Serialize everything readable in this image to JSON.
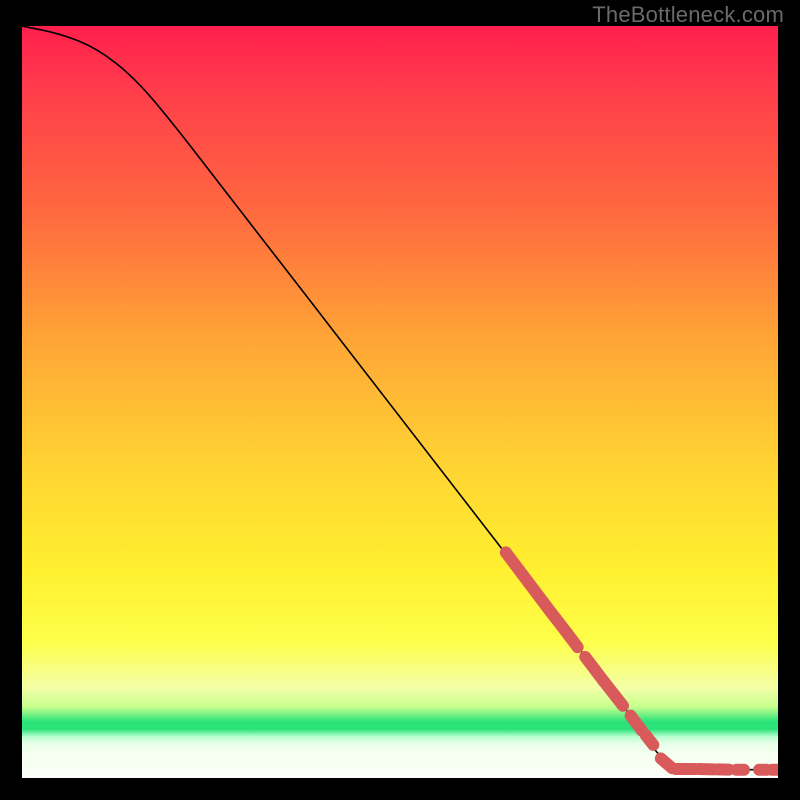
{
  "watermark": "TheBottleneck.com",
  "chart_data": {
    "type": "line",
    "title": "",
    "xlabel": "",
    "ylabel": "",
    "xlim": [
      0,
      100
    ],
    "ylim": [
      0,
      100
    ],
    "series": [
      {
        "name": "curve",
        "x": [
          0,
          5,
          10,
          15,
          20,
          25,
          30,
          35,
          40,
          45,
          50,
          55,
          60,
          65,
          70,
          75,
          80,
          82,
          85,
          90,
          95,
          100
        ],
        "y": [
          100,
          99,
          97,
          93,
          87,
          80.5,
          74,
          67.5,
          61,
          54.5,
          48,
          41.5,
          35,
          28.5,
          22,
          15.5,
          9,
          6,
          2,
          1.2,
          1.1,
          1.1
        ]
      }
    ],
    "highlight_segments": [
      {
        "x0": 64,
        "y0": 30.0,
        "x1": 67,
        "y1": 26.0
      },
      {
        "x0": 67,
        "y0": 26.0,
        "x1": 70,
        "y1": 22.0
      },
      {
        "x0": 70,
        "y0": 22.0,
        "x1": 72,
        "y1": 19.4
      },
      {
        "x0": 72,
        "y0": 19.4,
        "x1": 73.5,
        "y1": 17.4
      },
      {
        "x0": 74.5,
        "y0": 16.1,
        "x1": 77,
        "y1": 12.8
      },
      {
        "x0": 77,
        "y0": 12.8,
        "x1": 79.5,
        "y1": 9.6
      },
      {
        "x0": 80.5,
        "y0": 8.3,
        "x1": 82,
        "y1": 6.3
      },
      {
        "x0": 82.5,
        "y0": 5.7,
        "x1": 83.5,
        "y1": 4.4
      },
      {
        "x0": 84.5,
        "y0": 2.6,
        "x1": 86,
        "y1": 1.3
      },
      {
        "x0": 86.5,
        "y0": 1.2,
        "x1": 89,
        "y1": 1.2
      },
      {
        "x0": 89.5,
        "y0": 1.2,
        "x1": 91.5,
        "y1": 1.15
      },
      {
        "x0": 92,
        "y0": 1.15,
        "x1": 93.5,
        "y1": 1.12
      },
      {
        "x0": 94.5,
        "y0": 1.1,
        "x1": 95.5,
        "y1": 1.1
      },
      {
        "x0": 97.5,
        "y0": 1.1,
        "x1": 98.5,
        "y1": 1.1
      },
      {
        "x0": 99.2,
        "y0": 1.1,
        "x1": 100,
        "y1": 1.1
      }
    ],
    "gradient_bands": [
      {
        "color": "red-pink",
        "from_pct": 0,
        "to_pct": 30
      },
      {
        "color": "orange",
        "from_pct": 30,
        "to_pct": 60
      },
      {
        "color": "yellow",
        "from_pct": 60,
        "to_pct": 88
      },
      {
        "color": "green",
        "from_pct": 91,
        "to_pct": 94
      },
      {
        "color": "pale",
        "from_pct": 94,
        "to_pct": 100
      }
    ]
  }
}
